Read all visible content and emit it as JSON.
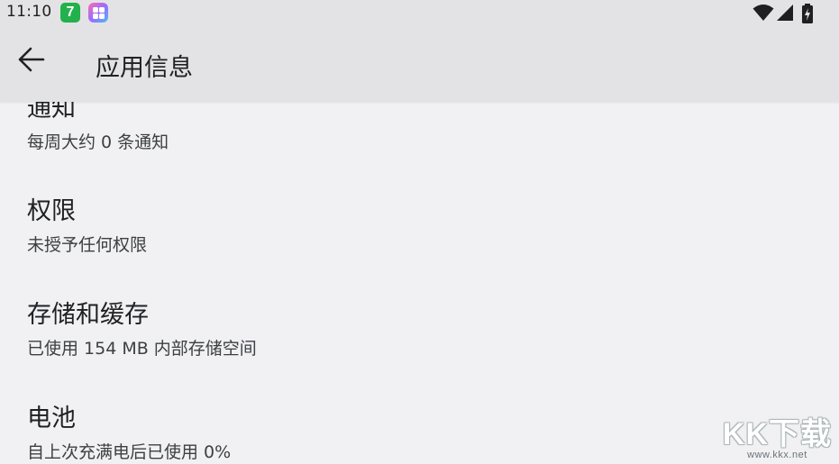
{
  "status_bar": {
    "time": "11:10",
    "app_icon_1_char": "7",
    "icons": [
      "wifi-icon",
      "cell-signal-icon",
      "battery-charging-icon"
    ]
  },
  "app_bar": {
    "title": "应用信息"
  },
  "items": [
    {
      "title": "通知",
      "subtitle": "每周大约 0 条通知"
    },
    {
      "title": "权限",
      "subtitle": "未授予任何权限"
    },
    {
      "title": "存储和缓存",
      "subtitle": "已使用 154 MB 内部存储空间"
    },
    {
      "title": "电池",
      "subtitle": "自上次充满电后已使用 0%"
    }
  ],
  "watermark": {
    "logo_text": "KK下载",
    "url": "www.kkx.net"
  },
  "colors": {
    "background": "#f1f1f4",
    "bar": "#e3e3e6",
    "text_primary": "#202124",
    "text_secondary": "#3c4043"
  }
}
